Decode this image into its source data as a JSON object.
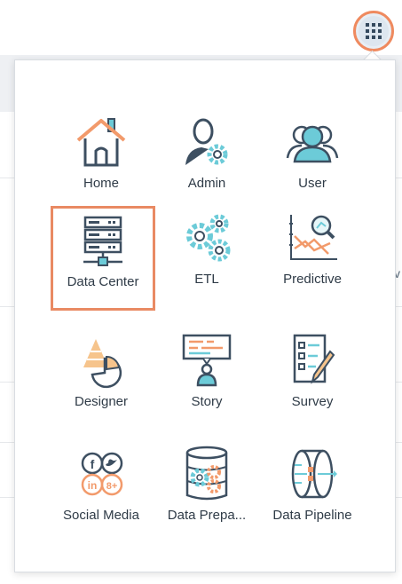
{
  "launcher": {
    "icon": "grid-icon",
    "accent": "#ef8a5f"
  },
  "apps": [
    {
      "label": "Home",
      "icon": "home-icon"
    },
    {
      "label": "Admin",
      "icon": "admin-icon"
    },
    {
      "label": "User",
      "icon": "user-icon"
    },
    {
      "label": "Data Center",
      "icon": "data-center-icon",
      "selected": true
    },
    {
      "label": "ETL",
      "icon": "etl-icon"
    },
    {
      "label": "Predictive",
      "icon": "predictive-icon"
    },
    {
      "label": "Designer",
      "icon": "designer-icon"
    },
    {
      "label": "Story",
      "icon": "story-icon"
    },
    {
      "label": "Survey",
      "icon": "survey-icon"
    },
    {
      "label": "Social Media",
      "icon": "social-media-icon"
    },
    {
      "label": "Data Prepa...",
      "icon": "data-prep-icon"
    },
    {
      "label": "Data Pipeline",
      "icon": "data-pipeline-icon"
    }
  ],
  "colors": {
    "primary": "#3d4f61",
    "accent": "#f29a6b",
    "teal": "#6ccbd8",
    "selection": "#e98a63"
  }
}
